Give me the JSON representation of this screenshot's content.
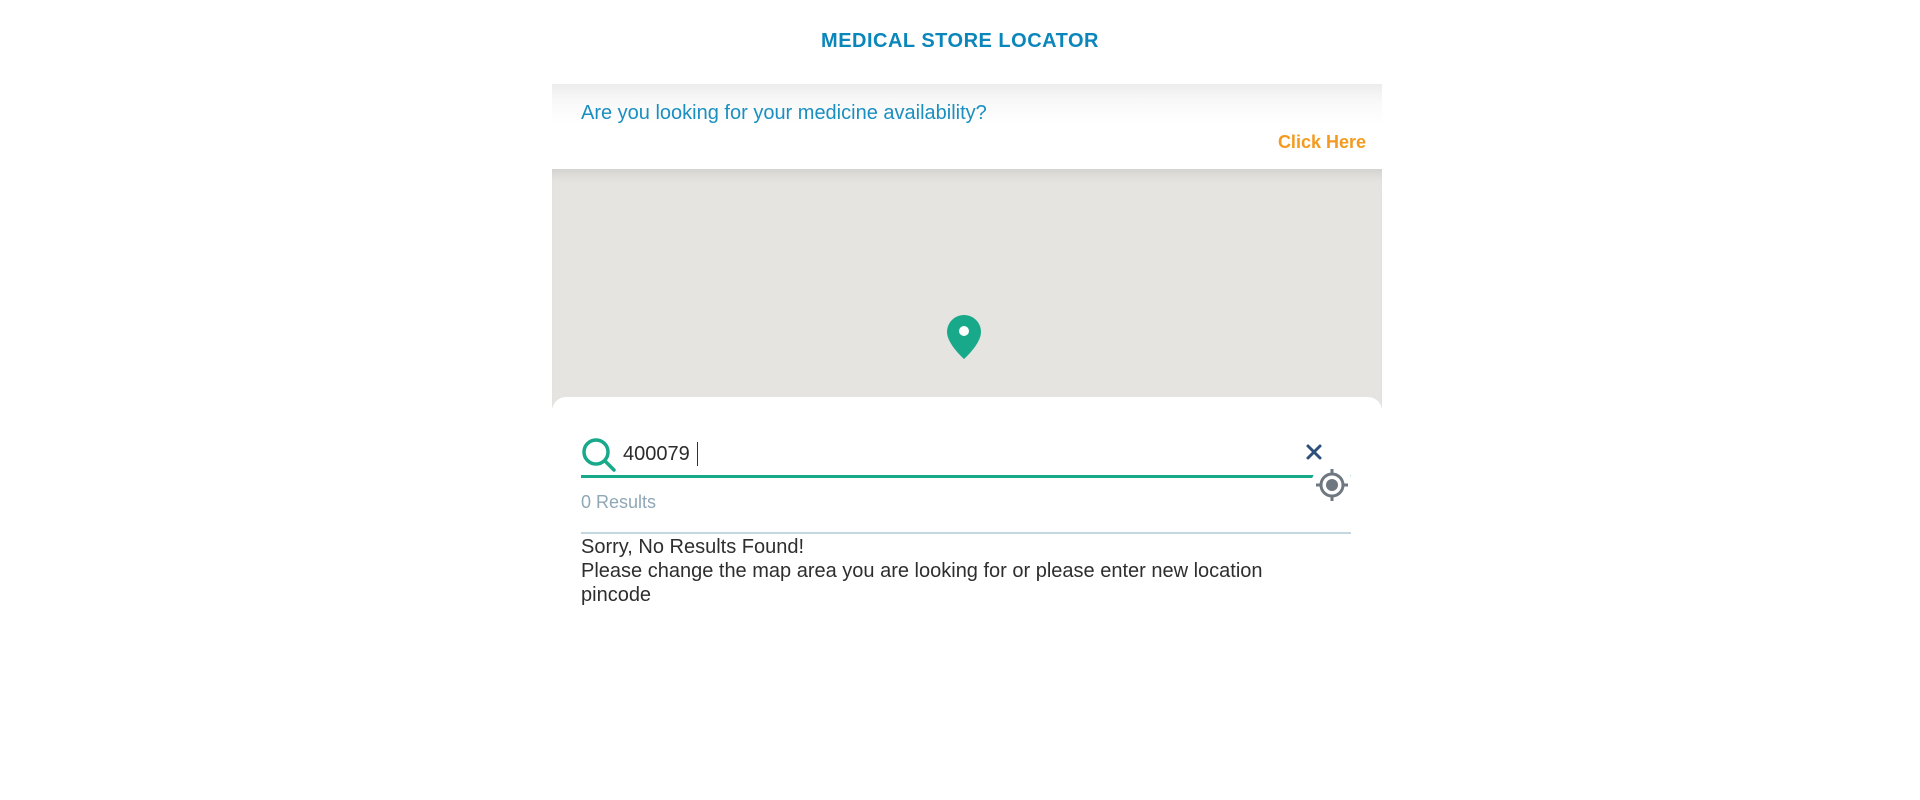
{
  "header": {
    "title": "MEDICAL STORE LOCATOR"
  },
  "banner": {
    "question": "Are you looking for your medicine availability?",
    "link_label": "Click Here"
  },
  "map": {
    "pin_icon": "map-pin-icon",
    "pin_color": "#17a98a",
    "background_color": "#e5e4e0"
  },
  "search": {
    "value": "400079",
    "placeholder": "",
    "icon": "search-icon",
    "clear_icon": "close-icon",
    "accent_color": "#17a98a"
  },
  "locate": {
    "icon": "crosshair-target-icon"
  },
  "results": {
    "count_text": "0 Results",
    "empty_title": "Sorry, No Results Found!",
    "empty_message": "Please change the map area you are looking for or please enter new location pincode"
  },
  "colors": {
    "title": "#0b86ba",
    "question": "#1a8fc0",
    "link": "#f39a1f"
  }
}
